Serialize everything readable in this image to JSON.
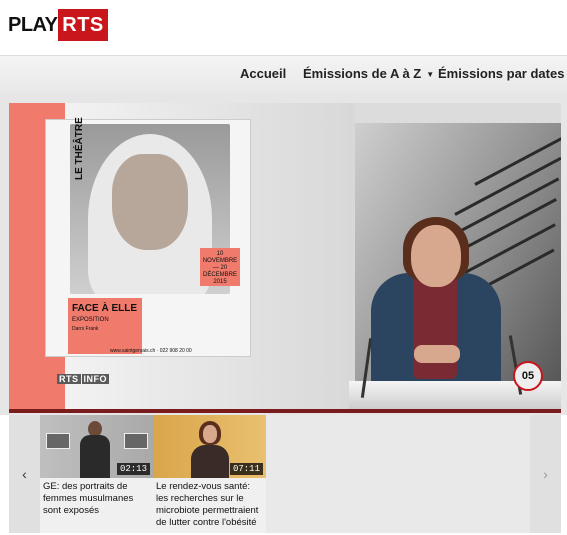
{
  "brand": {
    "play": "PLAY",
    "rts": "RTS",
    "rts_color": "#c9161c"
  },
  "nav": {
    "items": [
      {
        "label": "Accueil"
      },
      {
        "label": "Émissions de A à Z",
        "has_dropdown": true
      },
      {
        "label": "Émissions par dates"
      }
    ]
  },
  "video": {
    "channel_bug": [
      "RTS",
      "INFO"
    ],
    "clock_label": "05",
    "poster": {
      "label": "LE THÉÂTRE",
      "date_text": "10 NOVEMBRE — 20 DÉCEMBRE 2015",
      "title": "FACE À ELLE",
      "subtitle": "EXPOSITION",
      "author": "Darrs Frank",
      "url": "www.saintgervais.ch · 022 908 20 00"
    }
  },
  "carousel": {
    "prev_icon": "chevron-left-icon",
    "next_icon": "chevron-right-icon",
    "prev_symbol": "‹",
    "next_symbol": "›",
    "items": [
      {
        "title": "GE: des portraits de femmes musulmanes sont exposés",
        "duration": "02:13"
      },
      {
        "title": "Le rendez-vous santé: les recherches sur le microbiote permettraient de lutter contre l'obésité",
        "duration": "07:11"
      }
    ]
  }
}
